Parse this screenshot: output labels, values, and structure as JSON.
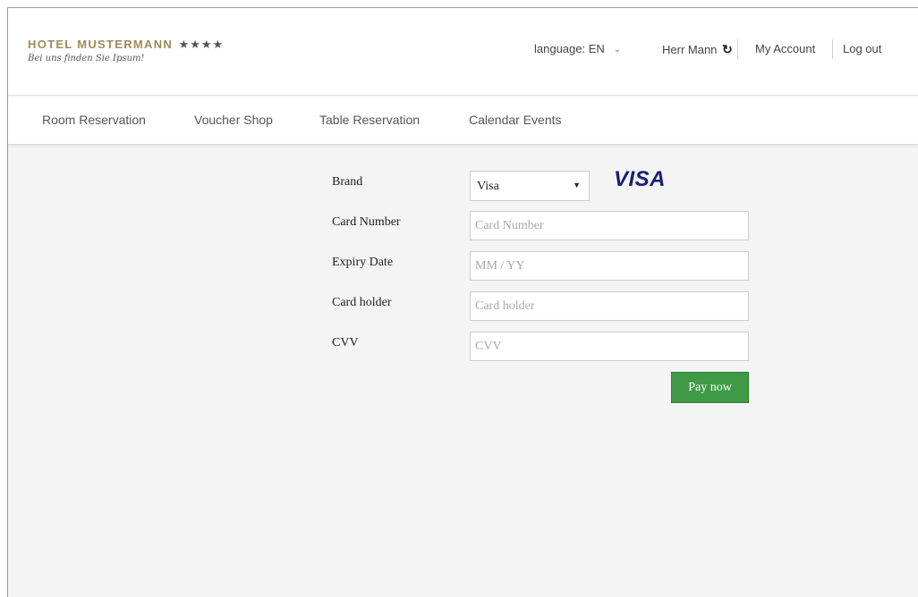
{
  "header": {
    "logo_title": "HOTEL MUSTERMANN",
    "logo_stars": "★★★★",
    "logo_tagline": "Bei uns finden Sie Ipsum!",
    "language_label": "language: EN",
    "language_chevron": "⌄",
    "user_name": "Herr Mann",
    "refresh_glyph": "↻",
    "my_account": "My Account",
    "logout": "Log out"
  },
  "nav": {
    "items": [
      {
        "label": "Room Reservation"
      },
      {
        "label": "Voucher Shop"
      },
      {
        "label": "Table Reservation"
      },
      {
        "label": "Calendar Events"
      }
    ]
  },
  "form": {
    "brand": {
      "label": "Brand",
      "value": "Visa",
      "arrow": "▼",
      "logo_text": "VISA",
      "logo_color": "#1a1f71"
    },
    "card_number": {
      "label": "Card Number",
      "value": "",
      "placeholder": "Card Number"
    },
    "expiry": {
      "label": "Expiry Date",
      "value": "",
      "placeholder": "MM / YY"
    },
    "holder": {
      "label": "Card holder",
      "value": "",
      "placeholder": "Card holder"
    },
    "cvv": {
      "label": "CVV",
      "value": "",
      "placeholder": "CVV"
    },
    "submit_label": "Pay now",
    "submit_color": "#3f9a48"
  },
  "colors": {
    "brand_gold": "#a08a5a",
    "page_background": "#f4f4f4"
  },
  "icons": {
    "refresh": "refresh-icon",
    "language_dropdown": "chevron-down-icon",
    "select_arrow": "caret-down-icon"
  }
}
